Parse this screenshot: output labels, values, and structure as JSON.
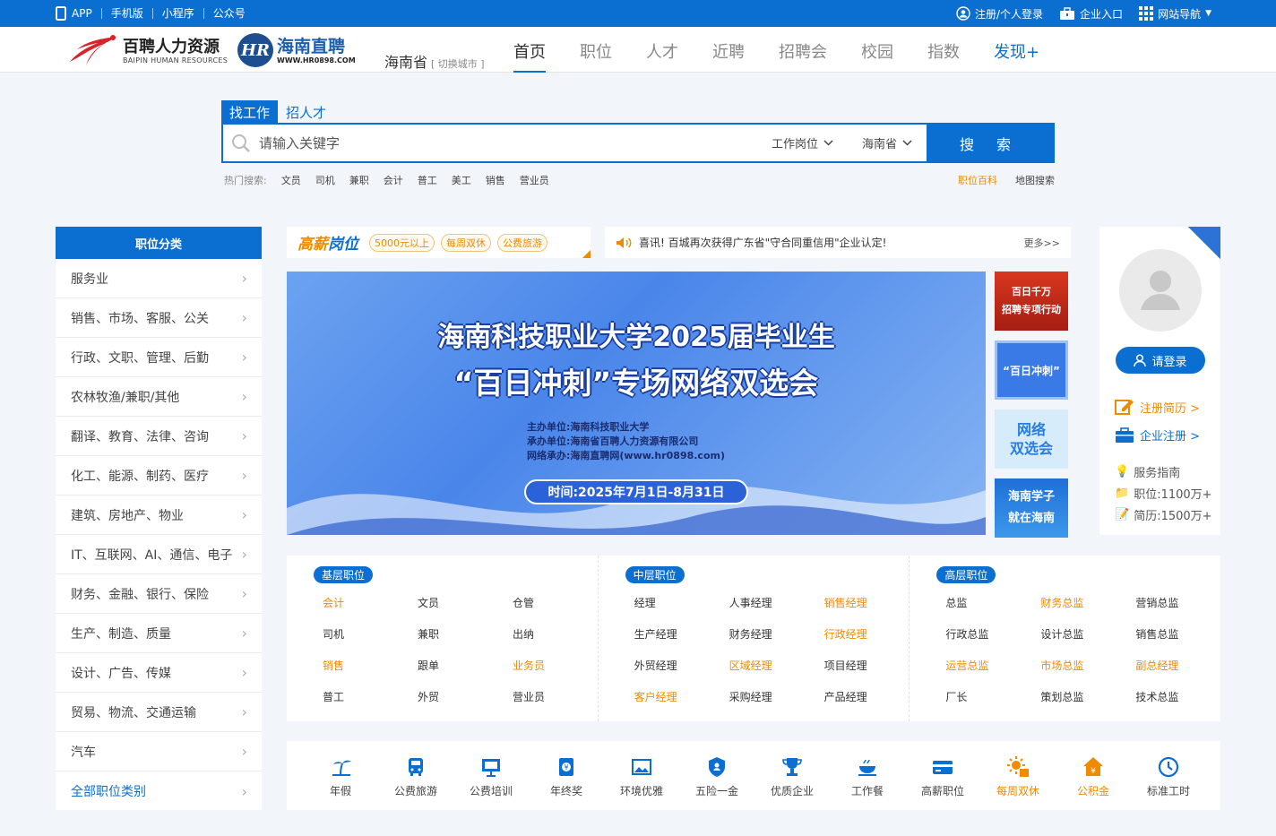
{
  "topbar": {
    "links": [
      "APP",
      "手机版",
      "小程序",
      "公众号"
    ],
    "login": "注册/个人登录",
    "company": "企业入口",
    "sitenav": "网站导航"
  },
  "header": {
    "logo1_cn": "百聘人力资源",
    "logo1_en": "BAIPIN HUMAN RESOURCES",
    "logo2_mark": "HR",
    "logo2_cn": "海南直聘",
    "logo2_en": "WWW.HR0898.COM",
    "city": "海南省",
    "city_switch": "[ 切换城市 ]",
    "nav": [
      "首页",
      "职位",
      "人才",
      "近聘",
      "招聘会",
      "校园",
      "指数"
    ],
    "nav_discover": "发现+"
  },
  "search": {
    "tabs": [
      "找工作",
      "招人才"
    ],
    "placeholder": "请输入关键字",
    "type_select": "工作岗位",
    "region_select": "海南省",
    "button": "搜 索",
    "hot_label": "热门搜索:",
    "hot": [
      "文员",
      "司机",
      "兼职",
      "会计",
      "普工",
      "美工",
      "销售",
      "营业员"
    ],
    "baike": "职位百科",
    "map": "地图搜索"
  },
  "categories": {
    "title": "职位分类",
    "items": [
      "服务业",
      "销售、市场、客服、公关",
      "行政、文职、管理、后勤",
      "农林牧渔/兼职/其他",
      "翻译、教育、法律、咨询",
      "化工、能源、制药、医疗",
      "建筑、房地产、物业",
      "IT、互联网、AI、通信、电子",
      "财务、金融、银行、保险",
      "生产、制造、质量",
      "设计、广告、传媒",
      "贸易、物流、交通运输",
      "汽车",
      "全部职位类别"
    ]
  },
  "highpay": {
    "logo_a": "高薪",
    "logo_b": "岗位",
    "tags": [
      "5000元以上",
      "每周双休",
      "公费旅游"
    ]
  },
  "notice": {
    "text": "喜讯! 百城再次获得广东省\"守合同重信用\"企业认定!",
    "more": "更多>>"
  },
  "banner": {
    "title1": "海南科技职业大学2025届毕业生",
    "title2": "“百日冲刺”专场网络双选会",
    "info": [
      "主办单位:海南科技职业大学",
      "承办单位:海南省百聘人力资源有限公司",
      "网络承办:海南直聘网(www.hr0898.com)"
    ],
    "time": "时间:2025年7月1日-8月31日"
  },
  "side_ads": [
    "百日千万\n招聘专项行动",
    "“百日冲刺”",
    "网络\n双选会",
    "海南学子\n就在海南"
  ],
  "user": {
    "login": "请登录",
    "register": "注册简历 >",
    "company": "企业注册 >",
    "guide": "服务指南",
    "jobs": "职位:1100万+",
    "resumes": "简历:1500万+"
  },
  "jobs": [
    {
      "label": "基层职位",
      "items": [
        [
          "会计",
          "o"
        ],
        [
          "文员",
          ""
        ],
        [
          "仓管",
          ""
        ],
        [
          "司机",
          ""
        ],
        [
          "兼职",
          ""
        ],
        [
          "出纳",
          ""
        ],
        [
          "销售",
          "o"
        ],
        [
          "跟单",
          ""
        ],
        [
          "业务员",
          "o"
        ],
        [
          "普工",
          ""
        ],
        [
          "外贸",
          ""
        ],
        [
          "营业员",
          ""
        ]
      ]
    },
    {
      "label": "中层职位",
      "items": [
        [
          "经理",
          ""
        ],
        [
          "人事经理",
          ""
        ],
        [
          "销售经理",
          "o"
        ],
        [
          "生产经理",
          ""
        ],
        [
          "财务经理",
          ""
        ],
        [
          "行政经理",
          "o"
        ],
        [
          "外贸经理",
          ""
        ],
        [
          "区域经理",
          "o"
        ],
        [
          "项目经理",
          ""
        ],
        [
          "客户经理",
          "o"
        ],
        [
          "采购经理",
          ""
        ],
        [
          "产品经理",
          ""
        ]
      ]
    },
    {
      "label": "高层职位",
      "items": [
        [
          "总监",
          ""
        ],
        [
          "财务总监",
          "o"
        ],
        [
          "营销总监",
          ""
        ],
        [
          "行政总监",
          ""
        ],
        [
          "设计总监",
          ""
        ],
        [
          "销售总监",
          ""
        ],
        [
          "运营总监",
          "o"
        ],
        [
          "市场总监",
          "o"
        ],
        [
          "副总经理",
          "o"
        ],
        [
          "厂长",
          ""
        ],
        [
          "策划总监",
          ""
        ],
        [
          "技术总监",
          ""
        ]
      ]
    }
  ],
  "benefits": [
    {
      "label": "年假",
      "icon": "beach-icon",
      "hl": false
    },
    {
      "label": "公费旅游",
      "icon": "bus-icon",
      "hl": false
    },
    {
      "label": "公费培训",
      "icon": "training-icon",
      "hl": false
    },
    {
      "label": "年终奖",
      "icon": "bonus-icon",
      "hl": false
    },
    {
      "label": "环境优雅",
      "icon": "picture-icon",
      "hl": false
    },
    {
      "label": "五险一金",
      "icon": "shield-icon",
      "hl": false
    },
    {
      "label": "优质企业",
      "icon": "trophy-icon",
      "hl": false
    },
    {
      "label": "工作餐",
      "icon": "meal-icon",
      "hl": false
    },
    {
      "label": "高薪职位",
      "icon": "card-icon",
      "hl": false
    },
    {
      "label": "每周双休",
      "icon": "sun-icon",
      "hl": true
    },
    {
      "label": "公积金",
      "icon": "house-icon",
      "hl": true
    },
    {
      "label": "标准工时",
      "icon": "clock-icon",
      "hl": false
    }
  ],
  "colors": {
    "primary": "#0b6fd1",
    "accent": "#f08a00"
  }
}
